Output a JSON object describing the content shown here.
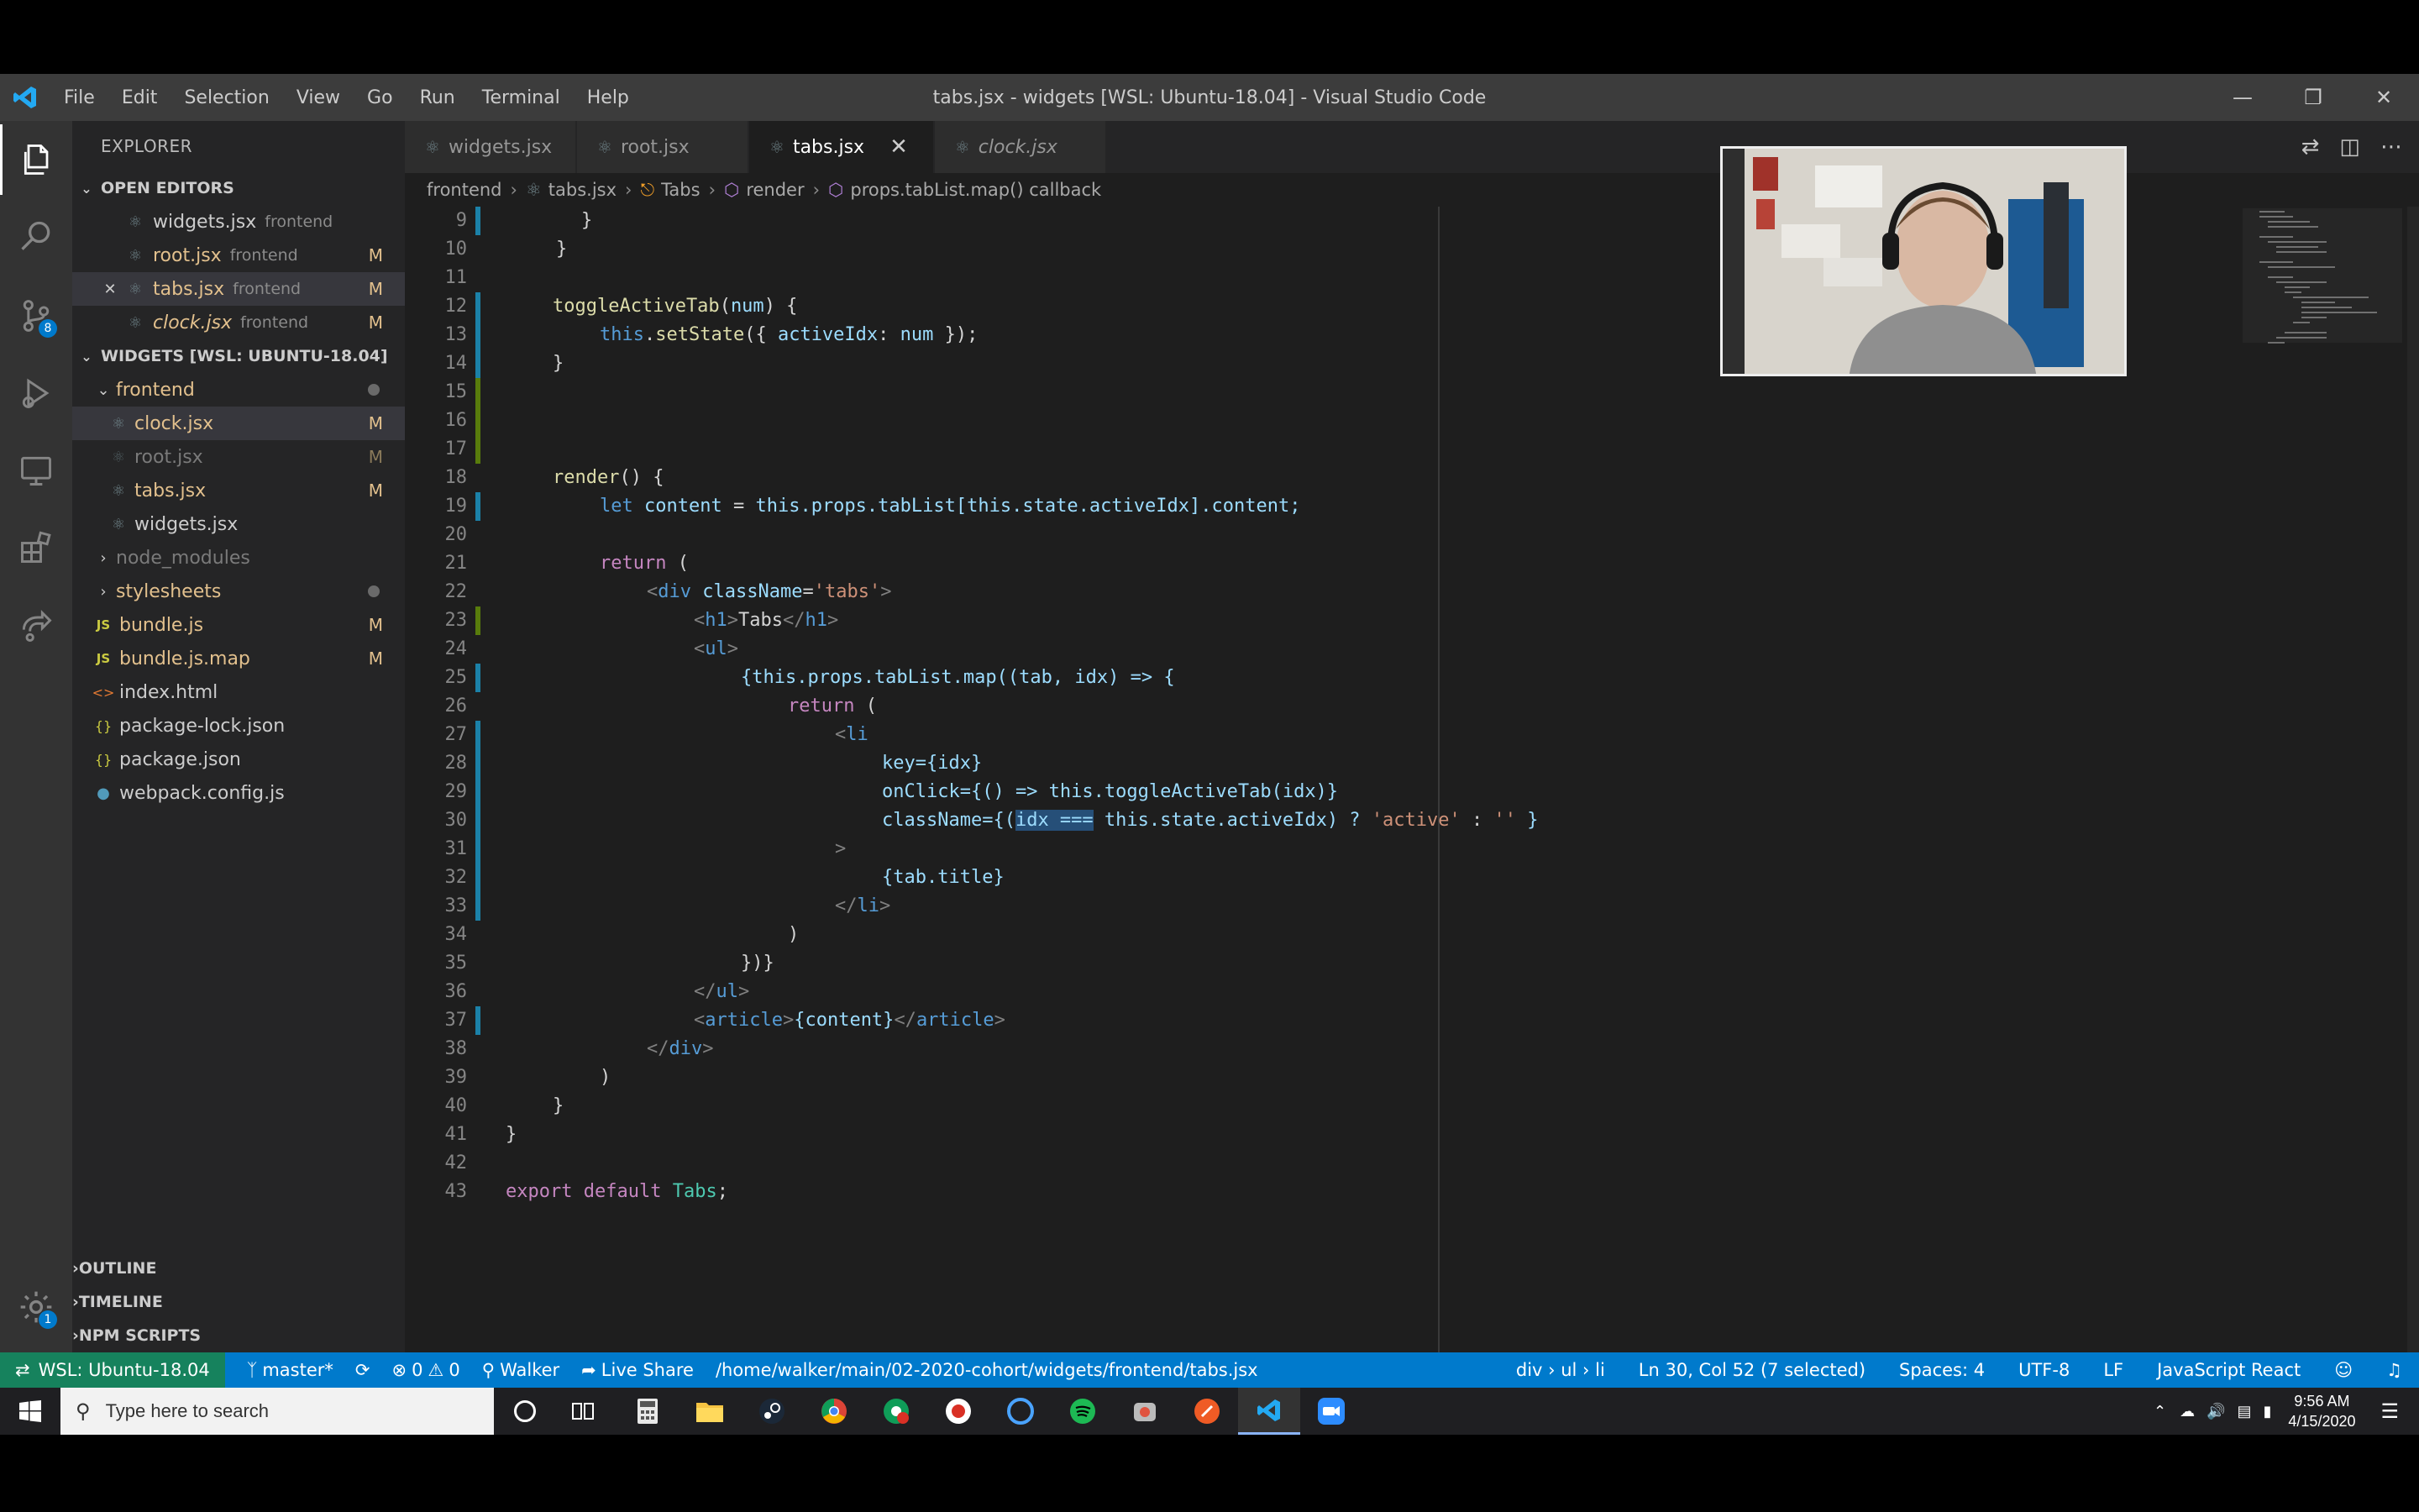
{
  "window": {
    "title": "tabs.jsx - widgets [WSL: Ubuntu-18.04] - Visual Studio Code",
    "menu": [
      "File",
      "Edit",
      "Selection",
      "View",
      "Go",
      "Run",
      "Terminal",
      "Help"
    ]
  },
  "activity": {
    "scm_badge": "8",
    "settings_badge": "1"
  },
  "sidebar": {
    "title": "EXPLORER",
    "open_editors_label": "OPEN EDITORS",
    "open_editors": [
      {
        "name": "widgets.jsx",
        "folder": "frontend",
        "status": ""
      },
      {
        "name": "root.jsx",
        "folder": "frontend",
        "status": "M"
      },
      {
        "name": "tabs.jsx",
        "folder": "frontend",
        "status": "M"
      },
      {
        "name": "clock.jsx",
        "folder": "frontend",
        "status": "M"
      }
    ],
    "workspace_label": "WIDGETS [WSL: UBUNTU-18.04]",
    "tree": [
      {
        "name": "frontend",
        "status": ""
      },
      {
        "name": "clock.jsx",
        "status": "M"
      },
      {
        "name": "root.jsx",
        "status": "M"
      },
      {
        "name": "tabs.jsx",
        "status": "M"
      },
      {
        "name": "widgets.jsx",
        "status": ""
      },
      {
        "name": "node_modules",
        "status": ""
      },
      {
        "name": "stylesheets",
        "status": ""
      },
      {
        "name": "bundle.js",
        "status": "M"
      },
      {
        "name": "bundle.js.map",
        "status": "M"
      },
      {
        "name": "index.html",
        "status": ""
      },
      {
        "name": "package-lock.json",
        "status": ""
      },
      {
        "name": "package.json",
        "status": ""
      },
      {
        "name": "webpack.config.js",
        "status": ""
      }
    ],
    "outline_label": "OUTLINE",
    "timeline_label": "TIMELINE",
    "npm_label": "NPM SCRIPTS"
  },
  "tabs": [
    "widgets.jsx",
    "root.jsx",
    "tabs.jsx",
    "clock.jsx"
  ],
  "active_tab": "tabs.jsx",
  "breadcrumb": [
    "frontend",
    "tabs.jsx",
    "Tabs",
    "render",
    "props.tabList.map() callback"
  ],
  "icons": {
    "logo": "vscode-icon",
    "explorer": "files-icon",
    "search": "search-icon",
    "scm": "source-control-icon",
    "run": "run-debug-icon",
    "remote": "remote-explorer-icon",
    "extensions": "extensions-icon",
    "live_share": "live-share-icon",
    "settings": "gear-icon"
  },
  "code_lines": [
    "9",
    "10",
    "11",
    "12",
    "13",
    "14",
    "15",
    "16",
    "17",
    "18",
    "19",
    "20",
    "21",
    "22",
    "23",
    "24",
    "25",
    "26",
    "27",
    "28",
    "29",
    "30",
    "31",
    "32",
    "33",
    "34",
    "35",
    "36",
    "37",
    "38",
    "39",
    "40",
    "41",
    "42",
    "43"
  ],
  "code": {
    "l9": "}",
    "l10": "}",
    "l12_fn": "toggleActiveTab",
    "l12_param": "num",
    "l13_this": "this",
    "l13_method": "setState",
    "l13_key": "activeIdx",
    "l13_val": "num",
    "l18_fn": "render",
    "l19_let": "let",
    "l19_var": "content",
    "l19_rest": "this.props.tabList[this.state.activeIdx].content;",
    "l21_return": "return",
    "l22_tag": "div",
    "l22_attr": "className",
    "l22_str": "'tabs'",
    "l23_text": "Tabs",
    "l25_expr": "{this.props.tabList.map((tab, idx) => {",
    "l26_return": "return",
    "l28": "key={idx}",
    "l29": "onClick={() => this.toggleActiveTab(idx)}",
    "l30_a": "className={(",
    "l30_sel": "idx ===",
    "l30_b": " this.state.activeIdx) ? ",
    "l30_s1": "'active'",
    "l30_c": " : ",
    "l30_s2": "''",
    "l32": "{tab.title}",
    "l37_content": "{content}",
    "l43_export": "export",
    "l43_default": "default",
    "l43_cls": "Tabs"
  },
  "status": {
    "remote": "WSL: Ubuntu-18.04",
    "branch": "master*",
    "errors": "0",
    "warnings": "0",
    "user": "Walker",
    "live_share": "Live Share",
    "path": "/home/walker/main/02-2020-cohort/widgets/frontend/tabs.jsx",
    "element_path": "div › ul › li",
    "cursor": "Ln 30, Col 52 (7 selected)",
    "spaces": "Spaces: 4",
    "encoding": "UTF-8",
    "eol": "LF",
    "language": "JavaScript React"
  },
  "taskbar": {
    "search_placeholder": "Type here to search",
    "time": "9:56 AM",
    "date": "4/15/2020"
  },
  "colors": {
    "status_bar": "#007acc",
    "remote_indicator": "#16825d",
    "editor_bg": "#1e1e1e",
    "sidebar_bg": "#252526"
  }
}
